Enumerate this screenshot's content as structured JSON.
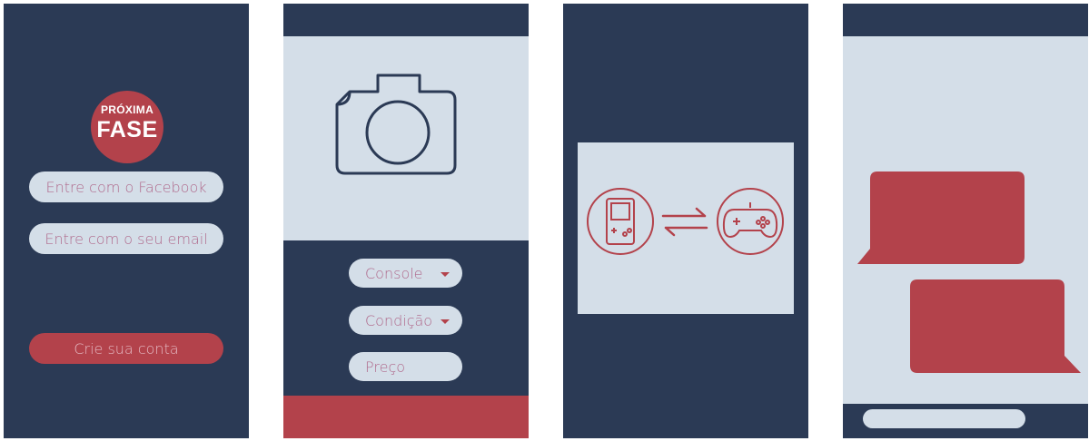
{
  "colors": {
    "navy": "#2b3a55",
    "light": "#d4dee8",
    "red": "#b3424b"
  },
  "login": {
    "logo_line1": "PRÓXIMA",
    "logo_line2": "FASE",
    "facebook_button": "Entre com o Facebook",
    "email_button": "Entre com o seu email",
    "signup_button": "Crie sua conta"
  },
  "listing": {
    "photo_icon": "camera-icon",
    "console_select": "Console",
    "condition_select": "Condição",
    "price_field": "Preço"
  },
  "trade": {
    "left_icon": "handheld-console-icon",
    "middle_icon": "exchange-arrows-icon",
    "right_icon": "gamepad-icon"
  },
  "chat": {
    "messages": [
      {
        "side": "left"
      },
      {
        "side": "right"
      }
    ]
  }
}
